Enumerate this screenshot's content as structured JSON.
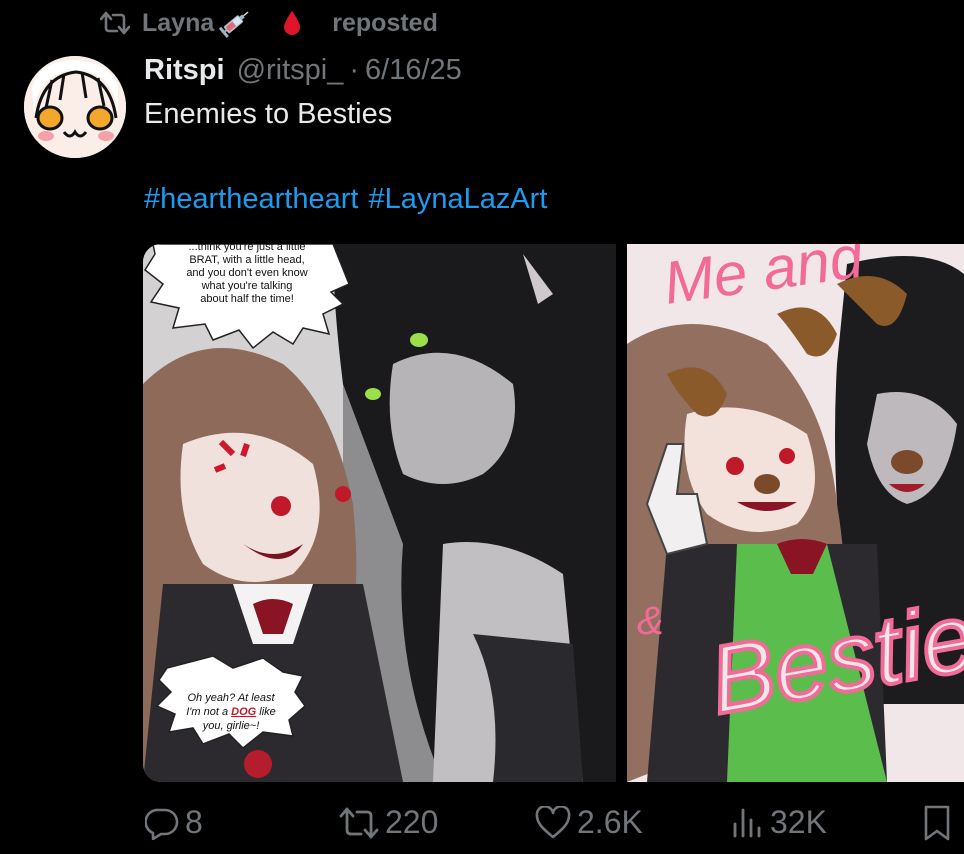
{
  "repost": {
    "reposter_name": "Layna",
    "label": "reposted",
    "emoji_icons": [
      "syringe-icon",
      "blood-drop-icon"
    ]
  },
  "post": {
    "display_name": "Ritspi",
    "handle": "@ritspi_",
    "separator": "·",
    "date": "6/16/25",
    "text": "Enemies to Besties",
    "hashtags": [
      "#heartheartheart",
      "#LaynaLazArt"
    ]
  },
  "media": {
    "image1": {
      "speech_top": [
        "...think you're just a little",
        "BRAT, with a little head,",
        "and you don't even know",
        "what you're talking",
        "about half the time!"
      ],
      "speech_bottom": [
        "Oh yeah? At least",
        "I'm not a",
        "DOG",
        "like",
        "you,",
        "girlie~!"
      ]
    },
    "image2": {
      "title_top": "Me and",
      "title_bottom": "Besties",
      "ampersand": "&"
    }
  },
  "actions": {
    "replies": "8",
    "reposts": "220",
    "likes": "2.6K",
    "views": "32K"
  },
  "colors": {
    "background": "#000000",
    "text": "#e7e9ea",
    "muted": "#71767b",
    "link": "#1d9bf0"
  }
}
